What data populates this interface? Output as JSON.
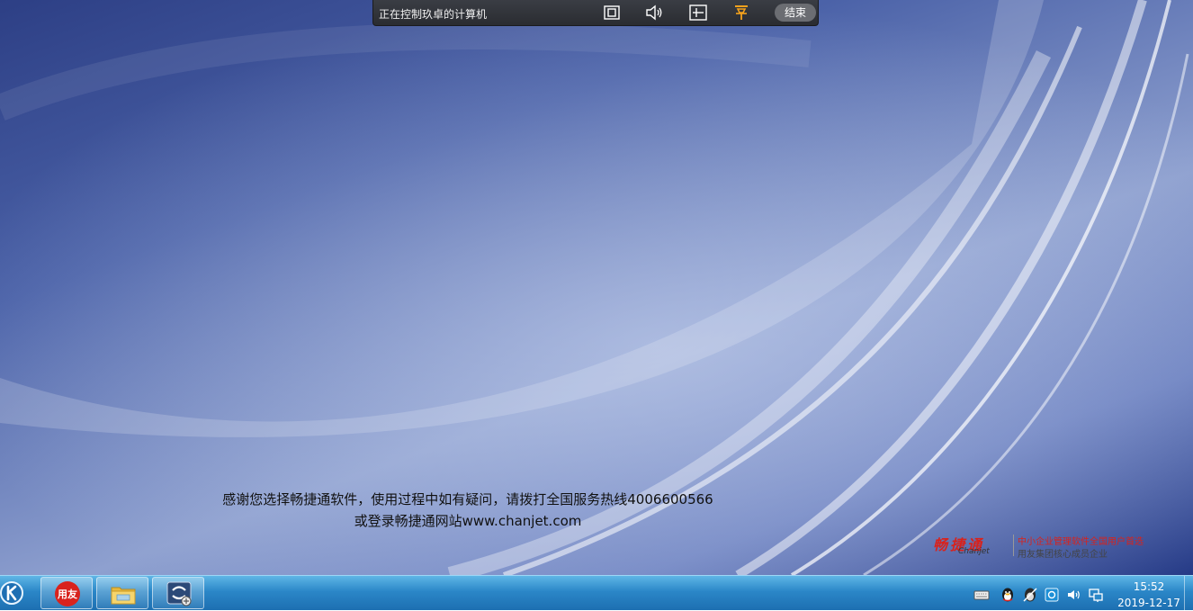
{
  "remote_toolbar": {
    "title": "正在控制玖卓的计算机",
    "end_label": "结束"
  },
  "desktop": {
    "message_line1": "感谢您选择畅捷通软件，使用过程中如有疑问，请拨打全国服务热线4006600566",
    "message_line2": "或登录畅捷通网站www.chanjet.com",
    "logo": {
      "name": "畅捷通",
      "sub": "Chanjet",
      "slogan1": "中小企业管理软件全国用户首选",
      "slogan2": "用友集团核心成员企业"
    }
  },
  "taskbar": {
    "pinned": [
      {
        "name": "yonyou-app",
        "label": "用友"
      },
      {
        "name": "file-explorer",
        "label": ""
      },
      {
        "name": "remote-tool",
        "label": ""
      }
    ],
    "clock": {
      "time": "15:52",
      "date": "2019-12-17"
    }
  },
  "colors": {
    "taskbar": "#2b87c8",
    "accent_red": "#d8221c",
    "toolbar": "#2f3136"
  }
}
